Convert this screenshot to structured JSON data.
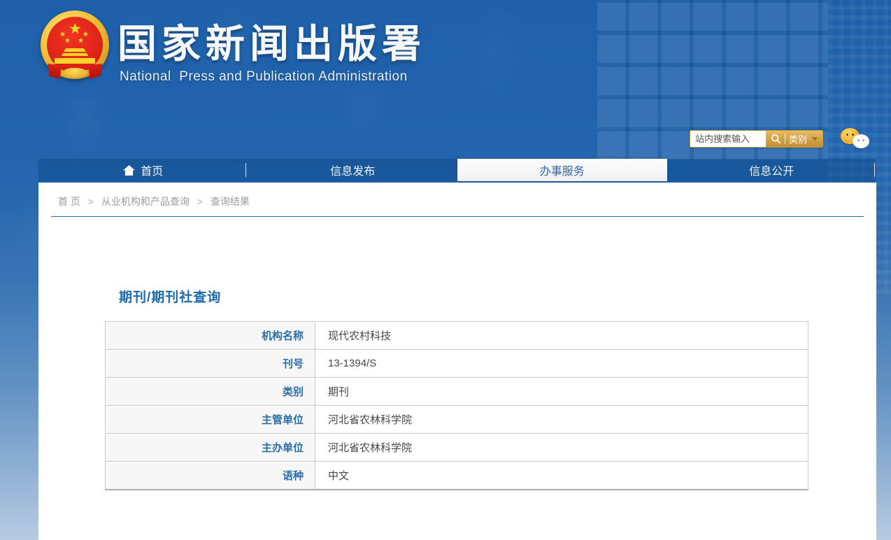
{
  "header": {
    "agency_name_cn": "国家新闻出版署",
    "agency_name_en": "National  Press and Publication Administration",
    "search": {
      "placeholder": "站内搜索输入",
      "category_label": "类别"
    }
  },
  "nav": {
    "items": [
      {
        "label": "首页",
        "active": false
      },
      {
        "label": "信息发布",
        "active": false
      },
      {
        "label": "办事服务",
        "active": true
      },
      {
        "label": "信息公开",
        "active": false
      }
    ]
  },
  "breadcrumb": {
    "separator": ">",
    "items": [
      "首 页",
      "从业机构和产品查询",
      "查询结果"
    ]
  },
  "main": {
    "section_title": "期刊/期刊社查询",
    "detail_table": {
      "rows": [
        {
          "label": "机构名称",
          "value": "现代农村科技"
        },
        {
          "label": "刊号",
          "value": "13-1394/S"
        },
        {
          "label": "类别",
          "value": "期刊"
        },
        {
          "label": "主管单位",
          "value": "河北省农林科学院"
        },
        {
          "label": "主办单位",
          "value": "河北省农林科学院"
        },
        {
          "label": "语种",
          "value": "中文"
        }
      ]
    }
  },
  "colors": {
    "header_blue": "#2164ad",
    "nav_blue": "#1c5da4",
    "active_tab_text": "#2e68a5",
    "accent_gold": "#cf9f45",
    "title_blue": "#1a6aad",
    "label_blue": "#2b6ea6",
    "breadcrumb_gray": "#9c9c9c",
    "divider_line_blue": "#2e6ca6"
  }
}
